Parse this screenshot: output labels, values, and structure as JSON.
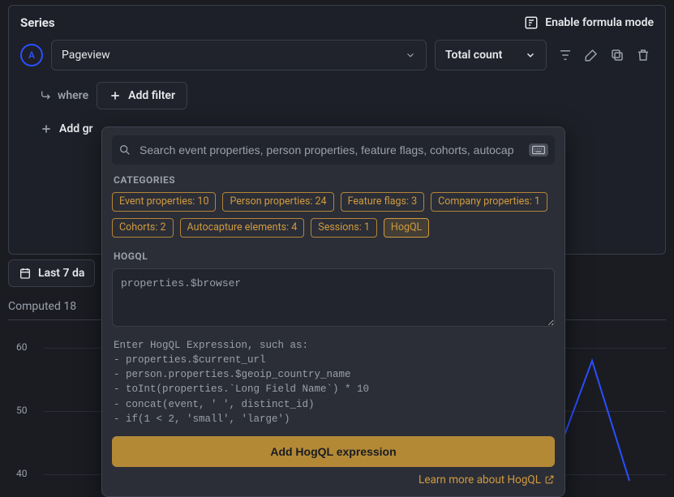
{
  "series": {
    "title": "Series",
    "formula_label": "Enable formula mode",
    "badge": "A",
    "event_value": "Pageview",
    "aggregation_value": "Total count",
    "where_label": "where",
    "add_filter_label": "Add filter",
    "add_group_label": "Add gr"
  },
  "popup": {
    "search_placeholder": "Search event properties, person properties, feature flags, cohorts, autocap",
    "categories_label": "CATEGORIES",
    "categories": [
      {
        "name": "Event properties",
        "count": 10,
        "selected": false
      },
      {
        "name": "Person properties",
        "count": 24,
        "selected": false
      },
      {
        "name": "Feature flags",
        "count": 3,
        "selected": false
      },
      {
        "name": "Company properties",
        "count": 1,
        "selected": false
      },
      {
        "name": "Cohorts",
        "count": 2,
        "selected": false
      },
      {
        "name": "Autocapture elements",
        "count": 4,
        "selected": false
      },
      {
        "name": "Sessions",
        "count": 1,
        "selected": false
      },
      {
        "name": "HogQL",
        "count": null,
        "selected": true
      }
    ],
    "hogql_label": "HOGQL",
    "hogql_value": "properties.$browser",
    "hint": "Enter HogQL Expression, such as:\n- properties.$current_url\n- person.properties.$geoip_country_name\n- toInt(properties.`Long Field Name`) * 10\n- concat(event, ' ', distinct_id)\n- if(1 < 2, 'small', 'large')",
    "add_expr_label": "Add HogQL expression",
    "learn_more_label": "Learn more about HogQL"
  },
  "results": {
    "date_label": "Last 7 da",
    "computed_label": "Computed 18"
  },
  "chart_data": {
    "type": "line",
    "y_ticks": [
      60,
      50,
      40
    ],
    "ylim": [
      40,
      65
    ],
    "x_range": [
      0,
      100
    ],
    "series": [
      {
        "name": "Pageview",
        "points": [
          [
            82,
            42
          ],
          [
            88,
            58
          ],
          [
            94,
            40
          ]
        ]
      }
    ]
  }
}
